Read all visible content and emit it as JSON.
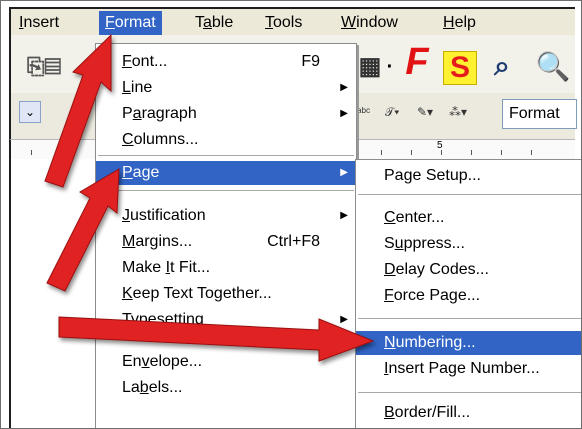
{
  "menubar": {
    "items": [
      "Insert",
      "Format",
      "Table",
      "Tools",
      "Window",
      "Help"
    ],
    "active": "Format"
  },
  "toolbar": {
    "format_box": "Format"
  },
  "format_menu": {
    "items": [
      {
        "label": "Font...",
        "shortcut": "F9",
        "submenu": false
      },
      {
        "label": "Line",
        "shortcut": "",
        "submenu": true
      },
      {
        "label": "Paragraph",
        "shortcut": "",
        "submenu": true
      },
      {
        "label": "Columns...",
        "shortcut": "",
        "submenu": false
      },
      {
        "label": "Page",
        "shortcut": "",
        "submenu": true,
        "selected": true
      },
      {
        "label": "Justification",
        "shortcut": "",
        "submenu": true
      },
      {
        "label": "Margins...",
        "shortcut": "Ctrl+F8",
        "submenu": false
      },
      {
        "label": "Make It Fit...",
        "shortcut": "",
        "submenu": false
      },
      {
        "label": "Keep Text Together...",
        "shortcut": "",
        "submenu": false
      },
      {
        "label": "Typesetting",
        "shortcut": "",
        "submenu": true
      },
      {
        "label": "Envelope...",
        "shortcut": "",
        "submenu": false
      },
      {
        "label": "Labels...",
        "shortcut": "",
        "submenu": false
      }
    ]
  },
  "page_submenu": {
    "items": [
      {
        "label": "Page Setup..."
      },
      {
        "label": "Center..."
      },
      {
        "label": "Suppress..."
      },
      {
        "label": "Delay Codes..."
      },
      {
        "label": "Force Page..."
      },
      {
        "label": "Numbering...",
        "selected": true
      },
      {
        "label": "Insert Page Number..."
      },
      {
        "label": "Border/Fill..."
      }
    ]
  },
  "colors": {
    "highlight": "#3164c5",
    "arrow": "#e02424",
    "menu_bg": "#ffffff",
    "toolbar_bg": "#ece9d8"
  },
  "icons": [
    "paste-icon",
    "table-grid-icon",
    "format-f-icon",
    "styles-s-icon",
    "zoom-icon",
    "find-icon"
  ]
}
